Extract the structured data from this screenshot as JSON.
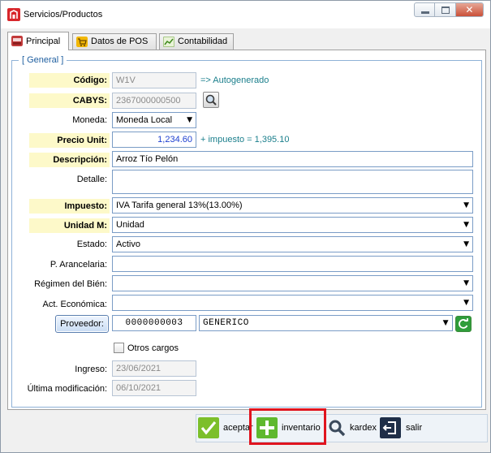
{
  "window": {
    "title": "Servicios/Productos",
    "controls": {
      "minimize": "minimize-icon",
      "maximize": "maximize-icon",
      "close": "close-icon"
    }
  },
  "tabs": [
    {
      "label": "Principal",
      "icon": "register-icon",
      "active": true
    },
    {
      "label": "Datos de POS",
      "icon": "pos-cart-icon",
      "active": false
    },
    {
      "label": "Contabilidad",
      "icon": "chart-icon",
      "active": false
    }
  ],
  "group": {
    "title": "[ General ]"
  },
  "form": {
    "codigo": {
      "label": "Código:",
      "value": "W1V",
      "hint": "=> Autogenerado"
    },
    "cabys": {
      "label": "CABYS:",
      "value": "2367000000500"
    },
    "moneda": {
      "label": "Moneda:",
      "value": "Moneda Local"
    },
    "precio": {
      "label": "Precio Unit:",
      "value": "1,234.60",
      "hint": "+ impuesto = 1,395.10"
    },
    "descripcion": {
      "label": "Descripción:",
      "value": "Arroz Tío Pelón"
    },
    "detalle": {
      "label": "Detalle:",
      "value": ""
    },
    "impuesto": {
      "label": "Impuesto:",
      "value": "IVA Tarifa general 13%(13.00%)"
    },
    "unidad": {
      "label": "Unidad M:",
      "value": "Unidad"
    },
    "estado": {
      "label": "Estado:",
      "value": "Activo"
    },
    "arancelaria": {
      "label": "P. Arancelaria:",
      "value": ""
    },
    "regimen": {
      "label": "Régimen del Bién:",
      "value": ""
    },
    "actividad": {
      "label": "Act. Económica:",
      "value": ""
    },
    "proveedor": {
      "button_label": "Proveedor:",
      "code": "0000000003",
      "name": "GENERICO"
    },
    "otros_cargos": {
      "label": "Otros cargos",
      "checked": false
    },
    "ingreso": {
      "label": "Ingreso:",
      "value": "23/06/2021"
    },
    "modificacion": {
      "label": "Última modificación:",
      "value": "06/10/2021"
    }
  },
  "actions": [
    {
      "label": "aceptar",
      "icon": "check-icon",
      "color": "#7cbf2a"
    },
    {
      "label": "inventario",
      "icon": "plus-icon",
      "color": "#5fb82e"
    },
    {
      "label": "kardex",
      "icon": "search-icon",
      "color": "#3b4a5c"
    },
    {
      "label": "salir",
      "icon": "exit-icon",
      "color": "#1f2f48"
    }
  ],
  "colors": {
    "required_label_bg": "#fdf9c9",
    "hint_text": "#1b7f8c",
    "price_text": "#1d3fd0",
    "highlight_border": "#e0141e",
    "group_title": "#1f5fa0"
  }
}
